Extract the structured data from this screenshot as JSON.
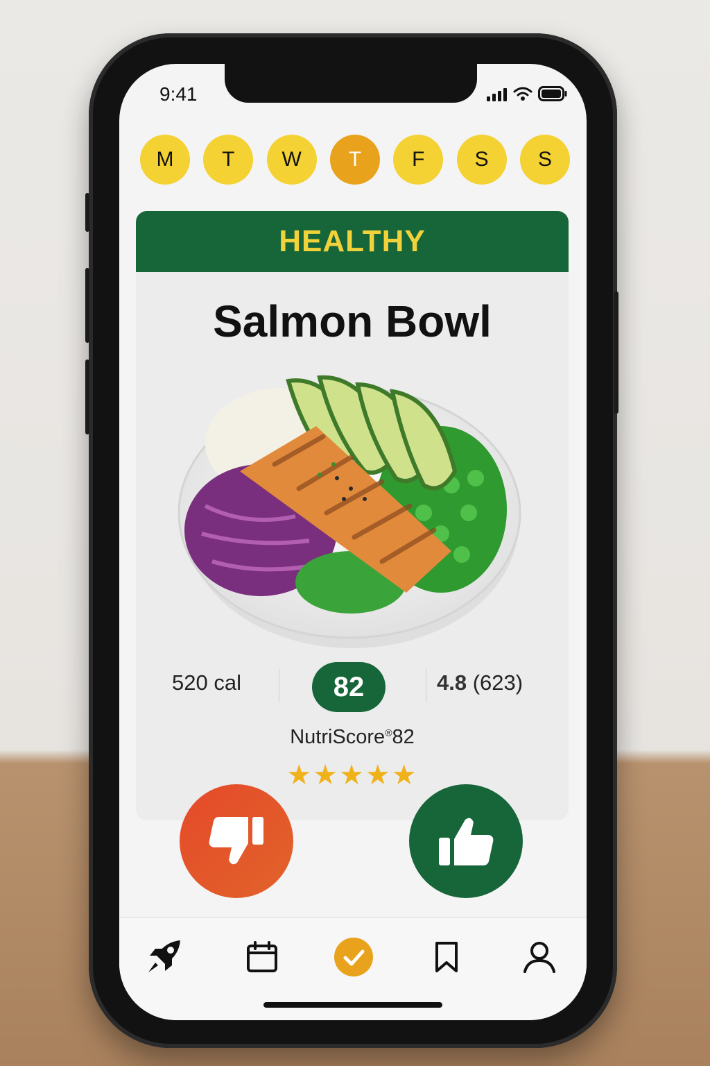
{
  "status": {
    "time": "9:41"
  },
  "days": [
    {
      "label": "M",
      "active": false
    },
    {
      "label": "T",
      "active": false
    },
    {
      "label": "W",
      "active": false
    },
    {
      "label": "T",
      "active": true
    },
    {
      "label": "F",
      "active": false
    },
    {
      "label": "S",
      "active": false
    },
    {
      "label": "S",
      "active": false
    }
  ],
  "card": {
    "badge": "HEALTHY",
    "title": "Salmon Bowl",
    "calories": "520 cal",
    "score": "82",
    "rating_value": "4.8",
    "rating_count": "(623)",
    "nutri_label": "NutriScore",
    "nutri_mark": "®",
    "nutri_value": "82",
    "stars": "★★★★★",
    "star_rating": 5
  },
  "colors": {
    "green": "#17663a",
    "yellow": "#f4d233",
    "orange": "#e8a21c",
    "red": "#e44a2a"
  },
  "tabs": [
    {
      "icon": "rocket-icon"
    },
    {
      "icon": "calendar-icon"
    },
    {
      "icon": "check-circle-icon",
      "active": true
    },
    {
      "icon": "bookmark-icon"
    },
    {
      "icon": "user-icon"
    }
  ]
}
